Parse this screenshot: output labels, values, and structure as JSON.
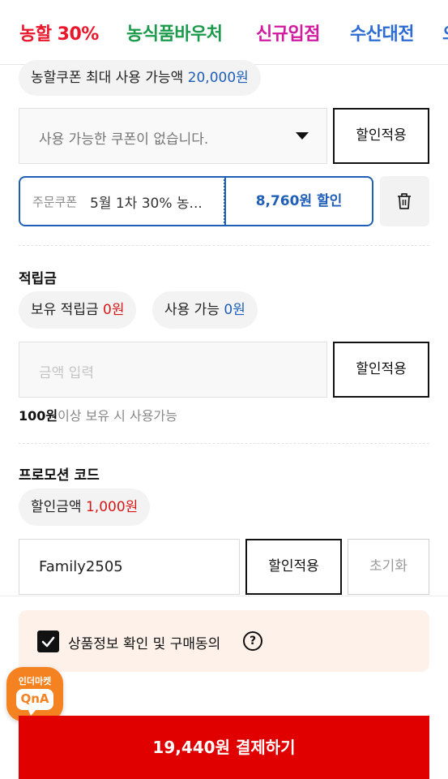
{
  "nav": {
    "tabs": [
      {
        "label": "농할 30%",
        "color": "#e8172b"
      },
      {
        "label": "농식품바우처",
        "color": "#1c9a4c"
      },
      {
        "label": "신규입점",
        "color": "#d21aa0"
      },
      {
        "label": "수산대전",
        "color": "#2c6bd3"
      },
      {
        "label": "오",
        "color": "#2c6bd3"
      }
    ]
  },
  "coupon": {
    "max_label": "농할쿠폰 최대 사용 가능액",
    "max_amount": "20,000원",
    "select_placeholder": "사용 가능한 쿠폰이 없습니다.",
    "apply_label": "할인적용",
    "order_coupon_tag": "주문쿠폰",
    "order_coupon_name": "5월 1차 30% 농...",
    "discount_text": "8,760원 할인"
  },
  "points": {
    "title": "적립금",
    "owned_label": "보유 적립금",
    "owned_value": "0원",
    "usable_label": "사용 가능",
    "usable_value": "0원",
    "input_placeholder": "금액 입력",
    "apply_label": "할인적용",
    "note_bold": "100원",
    "note_rest": "이상 보유 시 사용가능"
  },
  "promo": {
    "title": "프로모션 코드",
    "discount_label": "할인금액",
    "discount_value": "1,000원",
    "code_value": "Family2505",
    "apply_label": "할인적용",
    "reset_label": "초기화"
  },
  "agreement": {
    "checked": true,
    "label": "상품정보 확인 및 구매동의",
    "help_symbol": "?"
  },
  "qna_badge": {
    "line1": "인더마켓",
    "line2": "QnA"
  },
  "pay_button": {
    "label": "19,440원 결제하기",
    "color": "#e00000"
  }
}
